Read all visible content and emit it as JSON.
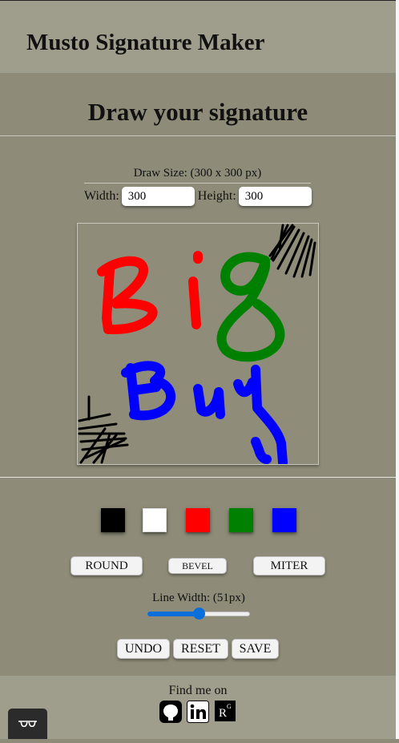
{
  "app": {
    "title": "Musto Signature Maker"
  },
  "section": {
    "title": "Draw your signature"
  },
  "draw_size": {
    "label": "Draw Size: (300 x 300 px)",
    "width_label": "Width:",
    "width_value": "300",
    "height_label": "Height:",
    "height_value": "300"
  },
  "colors": [
    {
      "name": "black",
      "hex": "#000000"
    },
    {
      "name": "white",
      "hex": "#ffffff"
    },
    {
      "name": "red",
      "hex": "#ff0000"
    },
    {
      "name": "green",
      "hex": "#008000"
    },
    {
      "name": "blue",
      "hex": "#0000ff"
    }
  ],
  "line_styles": {
    "round": "ROUND",
    "bevel": "BEVEL",
    "miter": "MITER"
  },
  "line_width": {
    "label": "Line Width: (51px)",
    "value": 51,
    "fraction": 0.5
  },
  "actions": {
    "undo": "UNDO",
    "reset": "RESET",
    "save": "SAVE"
  },
  "footer": {
    "find_me": "Find me on",
    "icons": [
      "github-icon",
      "linkedin-icon",
      "researchgate-icon"
    ]
  },
  "signature_text": [
    "Big",
    "Buy"
  ]
}
